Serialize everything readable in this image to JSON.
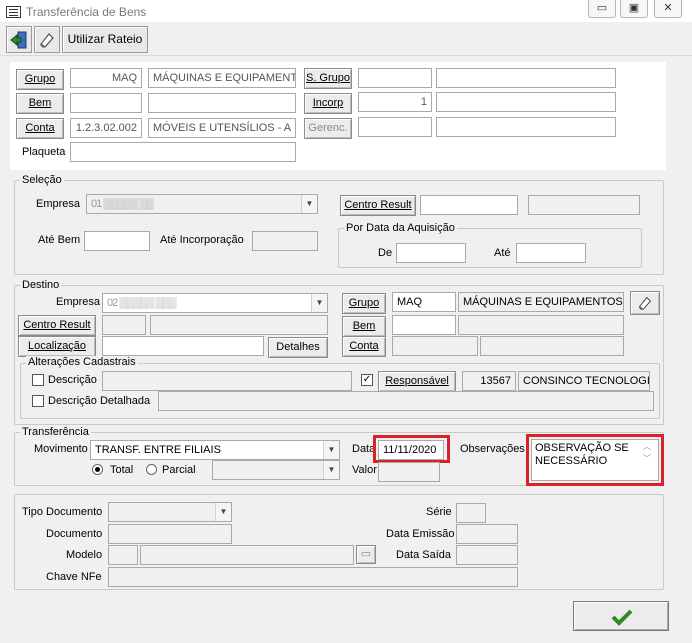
{
  "window": {
    "title": "Transferência de Bens",
    "minimize": "▭",
    "maximize": "▣",
    "close": "✕"
  },
  "toolbar": {
    "utilizar_rateio": "Utilizar Rateio"
  },
  "top": {
    "grupo_btn": "Grupo",
    "grupo_code": "MAQ",
    "grupo_desc": "MÁQUINAS E EQUIPAMENT",
    "bem_btn": "Bem",
    "bem_code": "",
    "bem_desc": "",
    "conta_btn": "Conta",
    "conta_code": "1.2.3.02.002",
    "conta_desc": "MÓVEIS E UTENSÍLIOS - A",
    "plaqueta_label": "Plaqueta",
    "plaqueta_value": "",
    "sgrupo_btn": "S. Grupo",
    "incorp_btn": "Incorp",
    "incorp_value": "1",
    "gerenc_btn": "Gerenc."
  },
  "selecao": {
    "legend": "Seleção",
    "empresa_label": "Empresa",
    "empresa_value": "01 ▒▒▒▒▒ ▒▒",
    "centro_result_btn": "Centro Result",
    "ate_bem_label": "Até Bem",
    "ate_incorp_label": "Até Incorporação",
    "aquisicao_legend": "Por Data da Aquisição",
    "de_label": "De",
    "ate_label": "Até"
  },
  "destino": {
    "legend": "Destino",
    "empresa_label": "Empresa",
    "empresa_value": "02 ▒▒▒▒▒ ▒▒▒",
    "grupo_btn": "Grupo",
    "grupo_code": "MAQ",
    "grupo_desc": "MÁQUINAS E EQUIPAMENTOS",
    "centro_result_btn": "Centro Result",
    "bem_btn": "Bem",
    "localizacao_btn": "Localização",
    "detalhes_btn": "Detalhes",
    "conta_btn": "Conta",
    "alteracoes_legend": "Alterações Cadastrais",
    "descricao_label": "Descrição",
    "descricao_detalhada_label": "Descrição Detalhada",
    "responsavel_btn": "Responsável",
    "responsavel_code": "13567",
    "responsavel_name": "CONSINCO TECNOLOGIA",
    "responsavel_checked": "✓"
  },
  "transferencia": {
    "legend": "Transferência",
    "movimento_label": "Movimento",
    "movimento_value": "TRANSF. ENTRE FILIAIS",
    "data_label": "Data",
    "data_value": "11/11/2020",
    "valor_label": "Valor",
    "observacoes_label": "Observações",
    "observacoes_value": "OBSERVAÇÃO SE NECESSÁRIO",
    "total_label": "Total",
    "parcial_label": "Parcial"
  },
  "nfe": {
    "tipo_documento_label": "Tipo Documento",
    "serie_label": "Série",
    "documento_label": "Documento",
    "data_emissao_label": "Data Emissão",
    "modelo_label": "Modelo",
    "data_saida_label": "Data Saída",
    "chave_nfe_label": "Chave NFe"
  },
  "colors": {
    "highlight": "#d9232a",
    "ok_check": "#2e8b1f"
  }
}
